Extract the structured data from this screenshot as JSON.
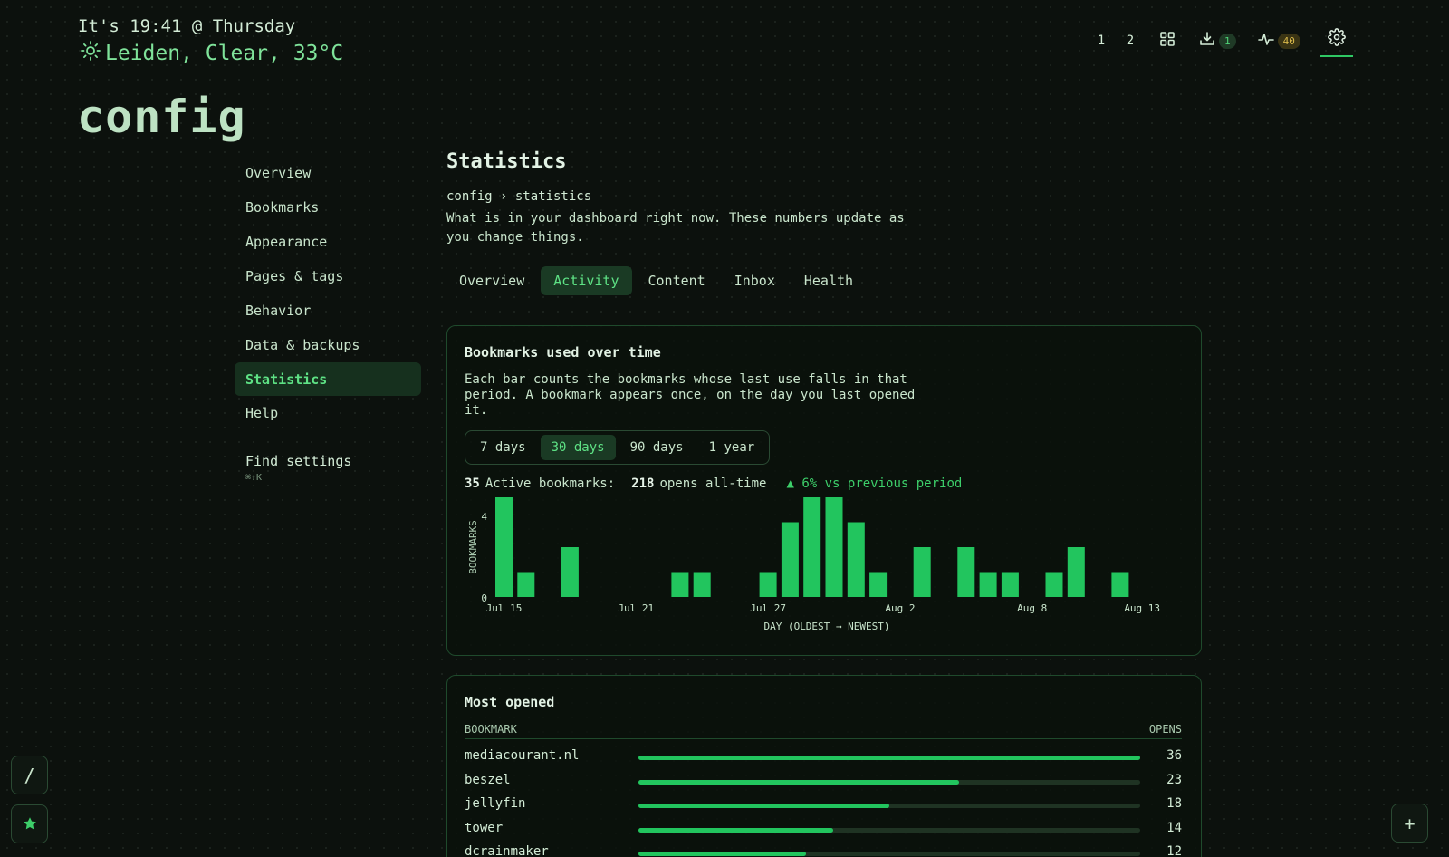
{
  "header": {
    "clock": "It's 19:41 @ Thursday",
    "weather": "Leiden, Clear, 33°C",
    "weather_icon": "sun-icon",
    "app_title": "config"
  },
  "topnav": {
    "page1": "1",
    "page2": "2",
    "grid_icon": "grid-icon",
    "inbox_icon": "inbox-download-icon",
    "inbox_count": "1",
    "pulse_icon": "pulse-icon",
    "health_count": "40",
    "settings_icon": "gear-icon"
  },
  "sidebar": {
    "items": [
      {
        "label": "Overview"
      },
      {
        "label": "Bookmarks"
      },
      {
        "label": "Appearance"
      },
      {
        "label": "Pages & tags"
      },
      {
        "label": "Behavior"
      },
      {
        "label": "Data & backups"
      },
      {
        "label": "Statistics",
        "active": true
      },
      {
        "label": "Help"
      }
    ],
    "find_label": "Find settings",
    "find_shortcut": "⌘⇧K"
  },
  "main": {
    "title": "Statistics",
    "breadcrumb": "config › statistics",
    "description": "What is in your dashboard right now. These numbers update as you change things.",
    "tabs": [
      {
        "label": "Overview"
      },
      {
        "label": "Activity",
        "active": true
      },
      {
        "label": "Content"
      },
      {
        "label": "Inbox"
      },
      {
        "label": "Health"
      }
    ]
  },
  "usage_card": {
    "title": "Bookmarks used over time",
    "description": "Each bar counts the bookmarks whose last use falls in that period. A bookmark appears once, on the day you last opened it.",
    "ranges": [
      {
        "label": "7 days"
      },
      {
        "label": "30 days",
        "active": true
      },
      {
        "label": "90 days"
      },
      {
        "label": "1 year"
      }
    ],
    "active_count": "35",
    "active_label": "Active bookmarks:",
    "opens_count": "218",
    "opens_label": "opens all-time",
    "delta": "▲ 6% vs previous period"
  },
  "chart_data": {
    "type": "bar",
    "categories": [
      "Jul 15",
      "Jul 16",
      "Jul 17",
      "Jul 18",
      "Jul 19",
      "Jul 20",
      "Jul 21",
      "Jul 22",
      "Jul 23",
      "Jul 24",
      "Jul 25",
      "Jul 26",
      "Jul 27",
      "Jul 28",
      "Jul 29",
      "Jul 30",
      "Jul 31",
      "Aug 1",
      "Aug 2",
      "Aug 3",
      "Aug 4",
      "Aug 5",
      "Aug 6",
      "Aug 7",
      "Aug 8",
      "Aug 9",
      "Aug 10",
      "Aug 11",
      "Aug 12",
      "Aug 13"
    ],
    "values": [
      4,
      1,
      0,
      2,
      0,
      0,
      0,
      0,
      1,
      1,
      0,
      0,
      1,
      3,
      4,
      4,
      3,
      1,
      0,
      2,
      0,
      2,
      1,
      1,
      0,
      1,
      2,
      0,
      1,
      0
    ],
    "xticks": [
      "Jul 15",
      "Jul 21",
      "Jul 27",
      "Aug 2",
      "Aug 8",
      "Aug 13"
    ],
    "yticks": [
      "0",
      "4"
    ],
    "xlabel": "DAY (OLDEST → NEWEST)",
    "ylabel": "BOOKMARKS",
    "ylim": [
      0,
      4
    ],
    "bar_color": "#22c55e",
    "grid": false
  },
  "most_opened": {
    "title": "Most opened",
    "col_bookmark": "BOOKMARK",
    "col_opens": "OPENS",
    "max": 36,
    "rows": [
      {
        "name": "mediacourant.nl",
        "opens": 36
      },
      {
        "name": "beszel",
        "opens": 23
      },
      {
        "name": "jellyfin",
        "opens": 18
      },
      {
        "name": "tower",
        "opens": 14
      },
      {
        "name": "dcrainmaker",
        "opens": 12
      }
    ]
  },
  "fabs": {
    "search": "/",
    "star_icon": "star-icon",
    "add": "+"
  },
  "colors": {
    "accent": "#22c55e",
    "background": "#0c110d",
    "active_bg": "#16301e",
    "amber": "#d8b84a"
  }
}
